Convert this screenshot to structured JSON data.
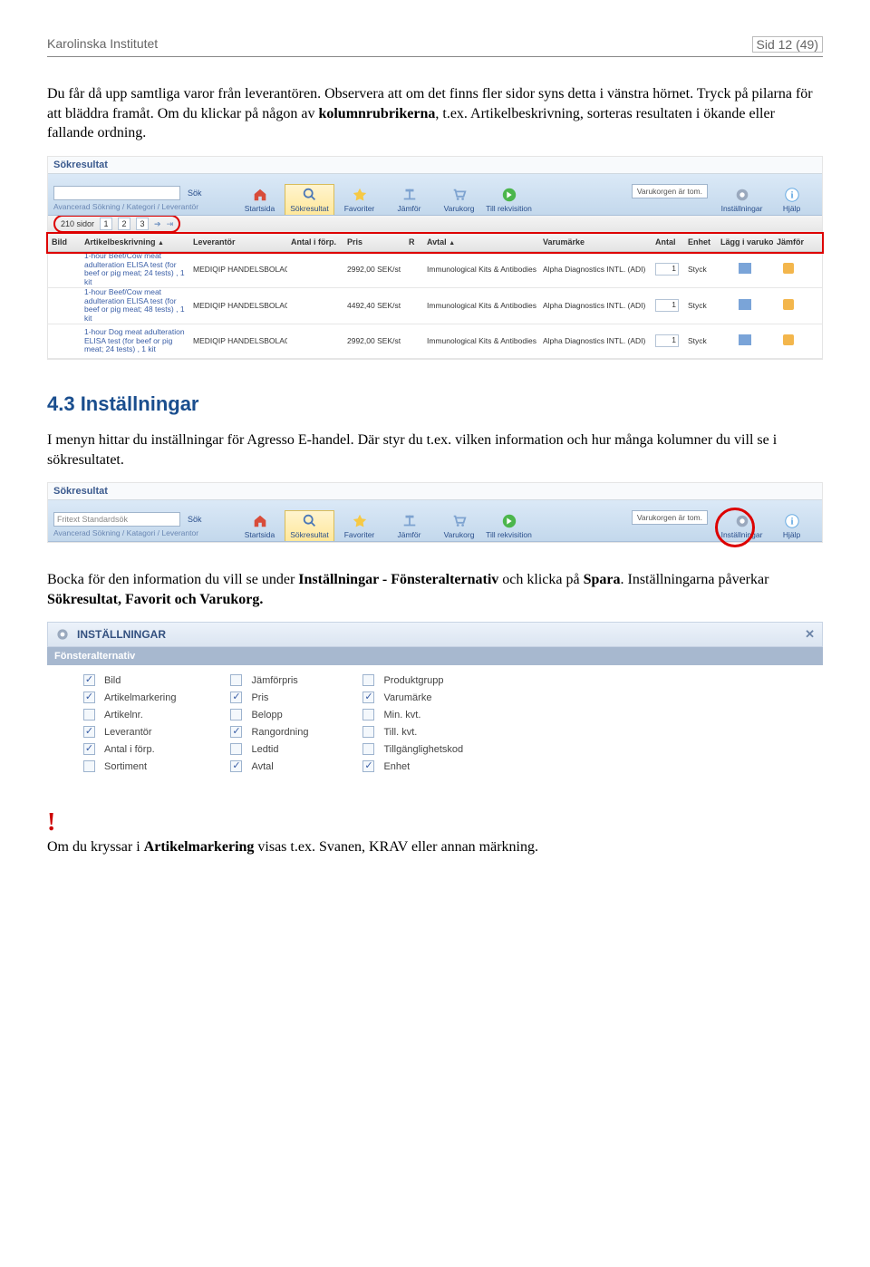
{
  "header": {
    "left": "Karolinska Institutet",
    "right": "Sid 12 (49)"
  },
  "para1": "Du får då upp samtliga varor från leverantören. Observera att om det finns fler sidor syns detta i vänstra hörnet. Tryck på pilarna för att bläddra framåt. Om du klickar på någon av ",
  "para1_b": "kolumnrubrikerna",
  "para1_after": ", t.ex. Artikelbeskrivning, sorteras resultaten i ökande eller fallande ordning.",
  "section43": "4.3  Inställningar",
  "para2": "I menyn hittar du inställningar för Agresso E-handel. Där styr du t.ex. vilken information och hur många kolumner du vill se i sökresultatet.",
  "para3_a": "Bocka för den information du vill se under ",
  "para3_b": "Inställningar - Fönsteralternativ",
  "para3_c": " och klicka på ",
  "para3_d": "Spara",
  "para3_e": ". Inställningarna påverkar ",
  "para3_f": "Sökresultat, Favorit och Varukorg.",
  "para4_a": "Om du kryssar i ",
  "para4_b": "Artikelmarkering",
  "para4_c": " visas t.ex. Svanen, KRAV eller annan märkning.",
  "ss1": {
    "title": "Sökresultat",
    "breadcrumb": "Avancerad Sökning  /  Kategori  /  Leverantör",
    "sok": "Sök",
    "nav": [
      "Startsida",
      "Sökresultat",
      "Favoriter",
      "Jämför",
      "Varukorg",
      "Till rekvisition"
    ],
    "rightNav": [
      "Inställningar",
      "Hjälp"
    ],
    "cartEmpty": "Varukorgen är tom.",
    "pageInfo": "210 sidor",
    "pages": [
      "1",
      "2",
      "3"
    ],
    "cols": [
      "Bild",
      "Artikelbeskrivning",
      "Leverantör",
      "Antal i förp.",
      "Pris",
      "R",
      "Avtal",
      "Varumärke",
      "Antal",
      "Enhet",
      "Lägg i varukorg",
      "Jämför"
    ],
    "rows": [
      {
        "desc": "1-hour Beef/Cow meat adulteration ELISA test (for beef or pig meat; 24 tests) , 1 kit",
        "lev": "MEDIQIP HANDELSBOLAG",
        "pris": "2992,00 SEK/st",
        "avtal": "Immunological Kits & Antibodies",
        "varum": "Alpha Diagnostics INTL. (ADI)",
        "antal": "1",
        "enhet": "Styck"
      },
      {
        "desc": "1-hour Beef/Cow meat adulteration ELISA test (for beef or pig meat; 48 tests) , 1 kit",
        "lev": "MEDIQIP HANDELSBOLAG",
        "pris": "4492,40 SEK/st",
        "avtal": "Immunological Kits & Antibodies",
        "varum": "Alpha Diagnostics INTL. (ADI)",
        "antal": "1",
        "enhet": "Styck"
      },
      {
        "desc": "1-hour Dog meat adulteration ELISA test (for beef or pig meat; 24 tests) , 1 kit",
        "lev": "MEDIQIP HANDELSBOLAG",
        "pris": "2992,00 SEK/st",
        "avtal": "Immunological Kits & Antibodies",
        "varum": "Alpha Diagnostics INTL. (ADI)",
        "antal": "1",
        "enhet": "Styck"
      }
    ]
  },
  "ss2": {
    "title": "Sökresultat",
    "searchText": "Fritext Standardsök",
    "breadcrumb": "Avancerad Sökning  /  Katagori  /  Leverantor",
    "sok": "Sök",
    "nav": [
      "Startsida",
      "Sökresultat",
      "Favoriter",
      "Jämför",
      "Varukorg",
      "Till rekvisition"
    ],
    "rightNav": [
      "Inställningar",
      "Hjälp"
    ],
    "cartEmpty": "Varukorgen är tom."
  },
  "settings": {
    "title": "INSTÄLLNINGAR",
    "subtitle": "Fönsteralternativ",
    "columns": [
      [
        {
          "l": "Bild",
          "on": true
        },
        {
          "l": "Artikelmarkering",
          "on": true
        },
        {
          "l": "Artikelnr.",
          "on": false
        },
        {
          "l": "Leverantör",
          "on": true
        },
        {
          "l": "Antal i förp.",
          "on": true
        },
        {
          "l": "Sortiment",
          "on": false
        }
      ],
      [
        {
          "l": "Jämförpris",
          "on": false
        },
        {
          "l": "Pris",
          "on": true
        },
        {
          "l": "Belopp",
          "on": false
        },
        {
          "l": "Rangordning",
          "on": true
        },
        {
          "l": "Ledtid",
          "on": false
        },
        {
          "l": "Avtal",
          "on": true
        }
      ],
      [
        {
          "l": "Produktgrupp",
          "on": false
        },
        {
          "l": "Varumärke",
          "on": true
        },
        {
          "l": "Min. kvt.",
          "on": false
        },
        {
          "l": "Till. kvt.",
          "on": false
        },
        {
          "l": "Tillgänglighetskod",
          "on": false
        },
        {
          "l": "Enhet",
          "on": true
        }
      ]
    ]
  }
}
